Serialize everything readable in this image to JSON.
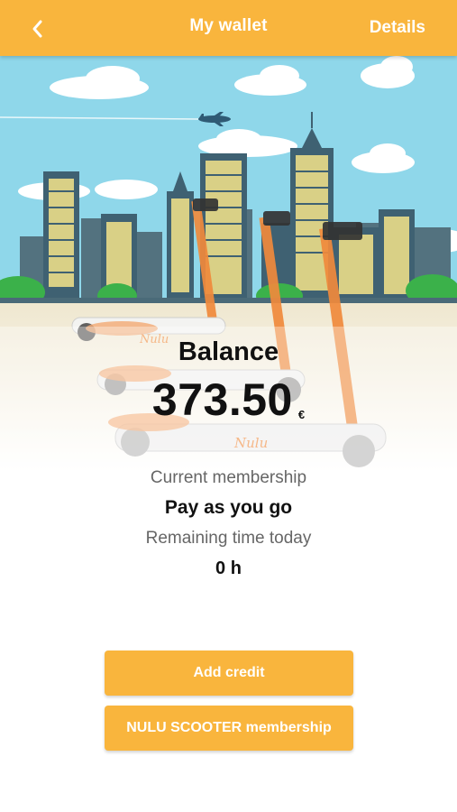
{
  "header": {
    "title": "My wallet",
    "details_label": "Details",
    "back_icon": "chevron-left-icon"
  },
  "hero": {
    "illustration": "city-skyline-with-scooters",
    "brand_mark": "Nulu"
  },
  "wallet": {
    "balance_label": "Balance",
    "balance_amount": "373.50",
    "currency_symbol": "€",
    "membership_label": "Current membership",
    "membership_value": "Pay as you go",
    "remaining_label": "Remaining time today",
    "remaining_value": "0 h"
  },
  "actions": {
    "add_credit_label": "Add credit",
    "membership_label": "NULU SCOOTER membership"
  },
  "colors": {
    "accent": "#f9b53d",
    "sky": "#8fd7ea",
    "scooter_orange": "#f08a3c"
  }
}
